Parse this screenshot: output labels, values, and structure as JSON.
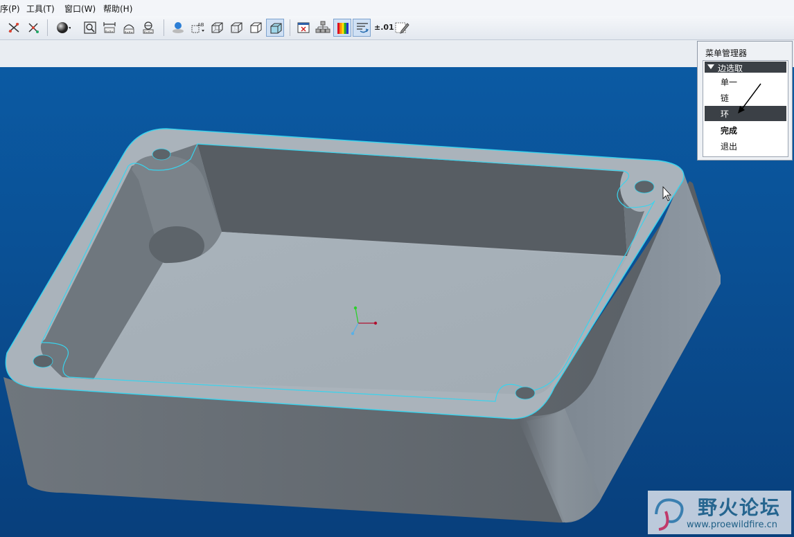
{
  "menubar": {
    "items": [
      {
        "label": "序(P)"
      },
      {
        "label": "工具(T)"
      },
      {
        "label": "窗口(W)"
      },
      {
        "label": "帮助(H)"
      }
    ]
  },
  "toolbar": {
    "tolerance_label": "±.01",
    "icons": [
      "hide-dim-icon",
      "show-dim-icon",
      "shading-icon",
      "refit-icon",
      "zoom-in-icon",
      "view-icon",
      "spin-center-icon",
      "display-style-icon",
      "saved-views-icon",
      "wireframe-icon",
      "hidden-line-icon",
      "no-hidden-icon",
      "shaded-icon",
      "close-window-icon",
      "model-tree-icon",
      "color-appearance-icon",
      "datum-display-icon",
      "annotation-icon"
    ]
  },
  "menu_manager": {
    "title": "菜单管理器",
    "header": "边选取",
    "items": [
      {
        "label": "单一",
        "selected": false,
        "bold": false
      },
      {
        "label": "链",
        "selected": false,
        "bold": false
      },
      {
        "label": "环",
        "selected": true,
        "bold": false
      },
      {
        "label": "完成",
        "selected": false,
        "bold": true
      },
      {
        "label": "退出",
        "selected": false,
        "bold": false
      }
    ]
  },
  "watermark": {
    "name": "野火论坛",
    "url": "www.proewildfire.cn"
  },
  "colors": {
    "viewport_top": "#0b5aa3",
    "viewport_bottom": "#083f7c",
    "highlight_edge": "#38d4ee",
    "selected_menu_bg": "#3b4046"
  }
}
